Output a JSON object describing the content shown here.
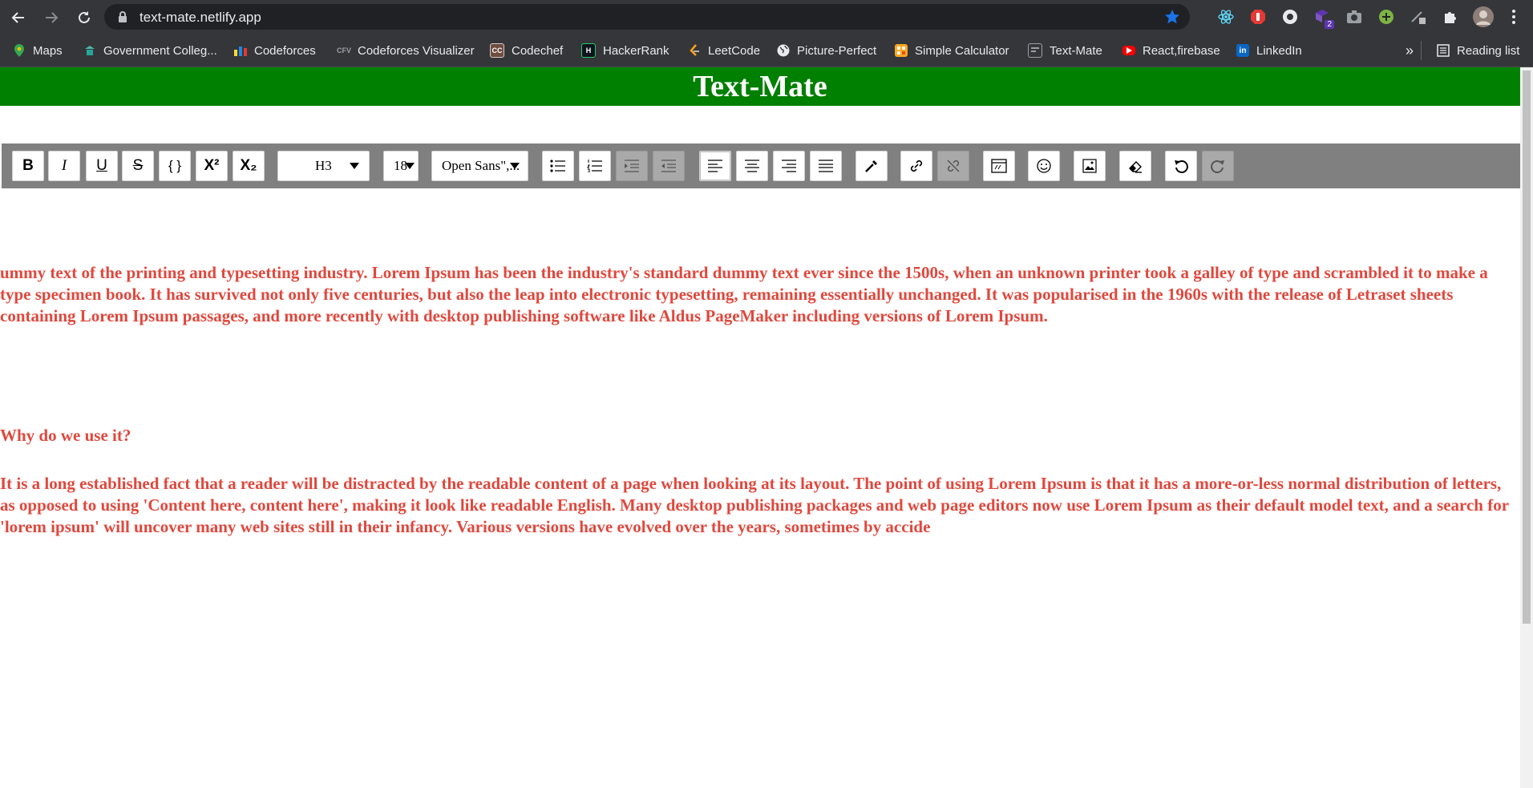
{
  "browser": {
    "url": "text-mate.netlify.app",
    "bookmarks": [
      {
        "label": "Maps",
        "icon": "maps-icon"
      },
      {
        "label": "Government Colleg...",
        "icon": "college-icon"
      },
      {
        "label": "Codeforces",
        "icon": "codeforces-icon"
      },
      {
        "label": "Codeforces Visualizer",
        "icon": "cfv-icon"
      },
      {
        "label": "Codechef",
        "icon": "codechef-icon"
      },
      {
        "label": "HackerRank",
        "icon": "hackerrank-icon"
      },
      {
        "label": "LeetCode",
        "icon": "leetcode-icon"
      },
      {
        "label": "Picture-Perfect",
        "icon": "globe-icon"
      },
      {
        "label": "Simple Calculator",
        "icon": "calculator-icon"
      },
      {
        "label": "Text-Mate",
        "icon": "textmate-icon"
      },
      {
        "label": "React,firebase",
        "icon": "youtube-icon"
      },
      {
        "label": "LinkedIn",
        "icon": "linkedin-icon"
      }
    ],
    "reading_list": "Reading list",
    "more_bookmarks": "»",
    "extension_badge": "2"
  },
  "app": {
    "title": "Text-Mate",
    "colors": {
      "header": "#008000",
      "toolbar": "#808080",
      "text": "#e0483d"
    }
  },
  "toolbar": {
    "bold": "B",
    "italic": "I",
    "underline": "U",
    "strike": "S",
    "code": "{ }",
    "superscript": "X²",
    "subscript": "X₂",
    "heading": "H3",
    "font_size": "18",
    "font_family": "Open Sans\",..."
  },
  "editor": {
    "paragraph1": "ummy text of the printing and typesetting industry. Lorem Ipsum has been the industry's standard dummy text ever since the 1500s, when an unknown printer took a galley of type and scrambled it to make a type specimen book. It has survived not only five centuries, but also the leap into electronic typesetting, remaining essentially unchanged. It was popularised in the 1960s with the release of Letraset sheets containing Lorem Ipsum passages, and more recently with desktop publishing software like Aldus PageMaker including versions of Lorem Ipsum.",
    "heading": "Why do we use it?",
    "paragraph2": "It is a long established fact that a reader will be distracted by the readable content of a page when looking at its layout. The point of using Lorem Ipsum is that it has a more-or-less normal distribution of letters, as opposed to using 'Content here, content here', making it look like readable English. Many desktop publishing packages and web page editors now use Lorem Ipsum as their default model text, and a search for 'lorem ipsum' will uncover many web sites still in their infancy. Various versions have evolved over the years, sometimes by accide"
  }
}
